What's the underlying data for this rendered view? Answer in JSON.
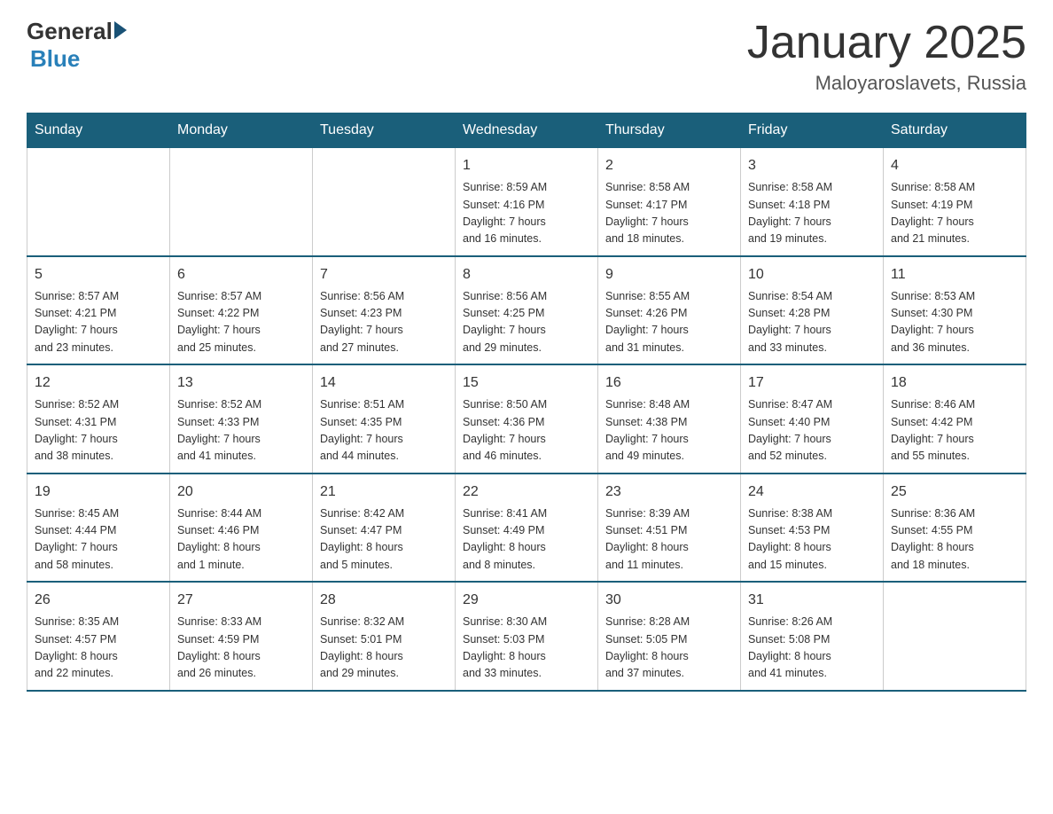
{
  "header": {
    "logo_general": "General",
    "logo_blue": "Blue",
    "title": "January 2025",
    "subtitle": "Maloyaroslavets, Russia"
  },
  "weekdays": [
    "Sunday",
    "Monday",
    "Tuesday",
    "Wednesday",
    "Thursday",
    "Friday",
    "Saturday"
  ],
  "weeks": [
    [
      {
        "day": "",
        "info": ""
      },
      {
        "day": "",
        "info": ""
      },
      {
        "day": "",
        "info": ""
      },
      {
        "day": "1",
        "info": "Sunrise: 8:59 AM\nSunset: 4:16 PM\nDaylight: 7 hours\nand 16 minutes."
      },
      {
        "day": "2",
        "info": "Sunrise: 8:58 AM\nSunset: 4:17 PM\nDaylight: 7 hours\nand 18 minutes."
      },
      {
        "day": "3",
        "info": "Sunrise: 8:58 AM\nSunset: 4:18 PM\nDaylight: 7 hours\nand 19 minutes."
      },
      {
        "day": "4",
        "info": "Sunrise: 8:58 AM\nSunset: 4:19 PM\nDaylight: 7 hours\nand 21 minutes."
      }
    ],
    [
      {
        "day": "5",
        "info": "Sunrise: 8:57 AM\nSunset: 4:21 PM\nDaylight: 7 hours\nand 23 minutes."
      },
      {
        "day": "6",
        "info": "Sunrise: 8:57 AM\nSunset: 4:22 PM\nDaylight: 7 hours\nand 25 minutes."
      },
      {
        "day": "7",
        "info": "Sunrise: 8:56 AM\nSunset: 4:23 PM\nDaylight: 7 hours\nand 27 minutes."
      },
      {
        "day": "8",
        "info": "Sunrise: 8:56 AM\nSunset: 4:25 PM\nDaylight: 7 hours\nand 29 minutes."
      },
      {
        "day": "9",
        "info": "Sunrise: 8:55 AM\nSunset: 4:26 PM\nDaylight: 7 hours\nand 31 minutes."
      },
      {
        "day": "10",
        "info": "Sunrise: 8:54 AM\nSunset: 4:28 PM\nDaylight: 7 hours\nand 33 minutes."
      },
      {
        "day": "11",
        "info": "Sunrise: 8:53 AM\nSunset: 4:30 PM\nDaylight: 7 hours\nand 36 minutes."
      }
    ],
    [
      {
        "day": "12",
        "info": "Sunrise: 8:52 AM\nSunset: 4:31 PM\nDaylight: 7 hours\nand 38 minutes."
      },
      {
        "day": "13",
        "info": "Sunrise: 8:52 AM\nSunset: 4:33 PM\nDaylight: 7 hours\nand 41 minutes."
      },
      {
        "day": "14",
        "info": "Sunrise: 8:51 AM\nSunset: 4:35 PM\nDaylight: 7 hours\nand 44 minutes."
      },
      {
        "day": "15",
        "info": "Sunrise: 8:50 AM\nSunset: 4:36 PM\nDaylight: 7 hours\nand 46 minutes."
      },
      {
        "day": "16",
        "info": "Sunrise: 8:48 AM\nSunset: 4:38 PM\nDaylight: 7 hours\nand 49 minutes."
      },
      {
        "day": "17",
        "info": "Sunrise: 8:47 AM\nSunset: 4:40 PM\nDaylight: 7 hours\nand 52 minutes."
      },
      {
        "day": "18",
        "info": "Sunrise: 8:46 AM\nSunset: 4:42 PM\nDaylight: 7 hours\nand 55 minutes."
      }
    ],
    [
      {
        "day": "19",
        "info": "Sunrise: 8:45 AM\nSunset: 4:44 PM\nDaylight: 7 hours\nand 58 minutes."
      },
      {
        "day": "20",
        "info": "Sunrise: 8:44 AM\nSunset: 4:46 PM\nDaylight: 8 hours\nand 1 minute."
      },
      {
        "day": "21",
        "info": "Sunrise: 8:42 AM\nSunset: 4:47 PM\nDaylight: 8 hours\nand 5 minutes."
      },
      {
        "day": "22",
        "info": "Sunrise: 8:41 AM\nSunset: 4:49 PM\nDaylight: 8 hours\nand 8 minutes."
      },
      {
        "day": "23",
        "info": "Sunrise: 8:39 AM\nSunset: 4:51 PM\nDaylight: 8 hours\nand 11 minutes."
      },
      {
        "day": "24",
        "info": "Sunrise: 8:38 AM\nSunset: 4:53 PM\nDaylight: 8 hours\nand 15 minutes."
      },
      {
        "day": "25",
        "info": "Sunrise: 8:36 AM\nSunset: 4:55 PM\nDaylight: 8 hours\nand 18 minutes."
      }
    ],
    [
      {
        "day": "26",
        "info": "Sunrise: 8:35 AM\nSunset: 4:57 PM\nDaylight: 8 hours\nand 22 minutes."
      },
      {
        "day": "27",
        "info": "Sunrise: 8:33 AM\nSunset: 4:59 PM\nDaylight: 8 hours\nand 26 minutes."
      },
      {
        "day": "28",
        "info": "Sunrise: 8:32 AM\nSunset: 5:01 PM\nDaylight: 8 hours\nand 29 minutes."
      },
      {
        "day": "29",
        "info": "Sunrise: 8:30 AM\nSunset: 5:03 PM\nDaylight: 8 hours\nand 33 minutes."
      },
      {
        "day": "30",
        "info": "Sunrise: 8:28 AM\nSunset: 5:05 PM\nDaylight: 8 hours\nand 37 minutes."
      },
      {
        "day": "31",
        "info": "Sunrise: 8:26 AM\nSunset: 5:08 PM\nDaylight: 8 hours\nand 41 minutes."
      },
      {
        "day": "",
        "info": ""
      }
    ]
  ]
}
